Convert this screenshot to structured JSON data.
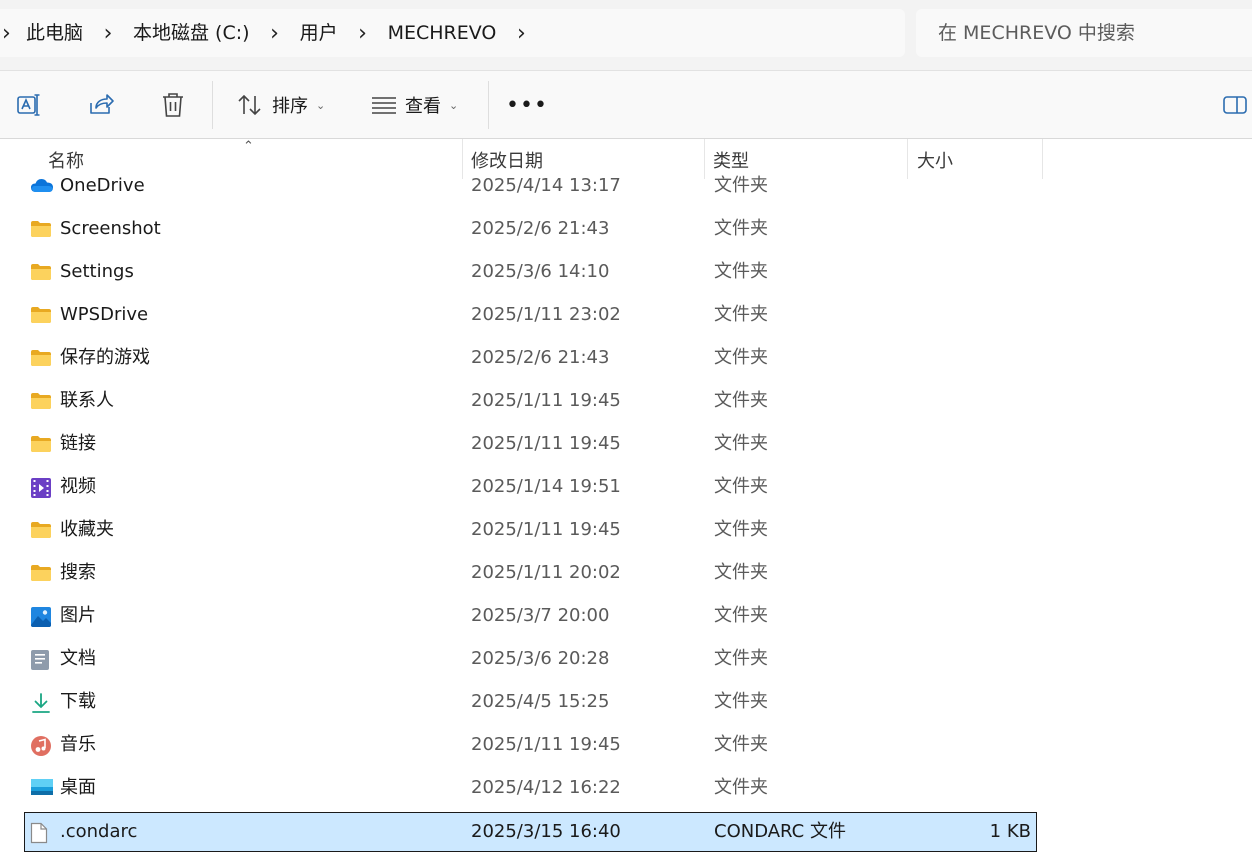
{
  "breadcrumb": [
    "此电脑",
    "本地磁盘 (C:)",
    "用户",
    "MECHREVO"
  ],
  "search": {
    "placeholder": "在 MECHREVO 中搜索"
  },
  "toolbar": {
    "sort_label": "排序",
    "view_label": "查看",
    "more_label": "•••"
  },
  "columns": {
    "name": "名称",
    "date": "修改日期",
    "type": "类型",
    "size": "大小"
  },
  "files": [
    {
      "name": "OneDrive",
      "date": "2025/4/14 13:17",
      "type": "文件夹",
      "size": "",
      "icon": "onedrive-icon"
    },
    {
      "name": "Screenshot",
      "date": "2025/2/6 21:43",
      "type": "文件夹",
      "size": "",
      "icon": "folder-icon"
    },
    {
      "name": "Settings",
      "date": "2025/3/6 14:10",
      "type": "文件夹",
      "size": "",
      "icon": "folder-icon"
    },
    {
      "name": "WPSDrive",
      "date": "2025/1/11 23:02",
      "type": "文件夹",
      "size": "",
      "icon": "folder-icon"
    },
    {
      "name": "保存的游戏",
      "date": "2025/2/6 21:43",
      "type": "文件夹",
      "size": "",
      "icon": "folder-icon"
    },
    {
      "name": "联系人",
      "date": "2025/1/11 19:45",
      "type": "文件夹",
      "size": "",
      "icon": "folder-icon"
    },
    {
      "name": "链接",
      "date": "2025/1/11 19:45",
      "type": "文件夹",
      "size": "",
      "icon": "folder-icon"
    },
    {
      "name": "视频",
      "date": "2025/1/14 19:51",
      "type": "文件夹",
      "size": "",
      "icon": "videos-folder-icon"
    },
    {
      "name": "收藏夹",
      "date": "2025/1/11 19:45",
      "type": "文件夹",
      "size": "",
      "icon": "folder-icon"
    },
    {
      "name": "搜索",
      "date": "2025/1/11 20:02",
      "type": "文件夹",
      "size": "",
      "icon": "folder-icon"
    },
    {
      "name": "图片",
      "date": "2025/3/7 20:00",
      "type": "文件夹",
      "size": "",
      "icon": "pictures-folder-icon"
    },
    {
      "name": "文档",
      "date": "2025/3/6 20:28",
      "type": "文件夹",
      "size": "",
      "icon": "documents-folder-icon"
    },
    {
      "name": "下载",
      "date": "2025/4/5 15:25",
      "type": "文件夹",
      "size": "",
      "icon": "downloads-folder-icon"
    },
    {
      "name": "音乐",
      "date": "2025/1/11 19:45",
      "type": "文件夹",
      "size": "",
      "icon": "music-folder-icon"
    },
    {
      "name": "桌面",
      "date": "2025/4/12 16:22",
      "type": "文件夹",
      "size": "",
      "icon": "desktop-folder-icon"
    },
    {
      "name": ".condarc",
      "date": "2025/3/15 16:40",
      "type": "CONDARC 文件",
      "size": "1 KB",
      "icon": "file-icon",
      "selected": true
    }
  ]
}
